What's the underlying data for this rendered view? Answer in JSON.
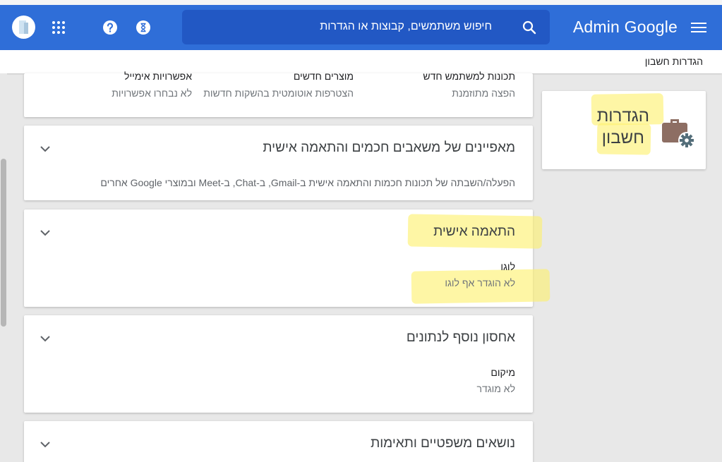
{
  "header": {
    "brand": "Admin Google",
    "search_placeholder": "חיפוש משתמשים, קבוצות או הגדרות"
  },
  "breadcrumb": "הגדרות חשבון",
  "top_card": {
    "columns": [
      {
        "label": "תכונות למשתמש חדש",
        "value": "הפצה מתוזמנת"
      },
      {
        "label": "מוצרים חדשים",
        "value": "הצטרפות אוטומטית בהשקות חדשות"
      },
      {
        "label": "אפשרויות אימייל",
        "value": "לא נבחרו אפשרויות"
      }
    ]
  },
  "sections": [
    {
      "title": "מאפיינים של משאבים חכמים והתאמה אישית",
      "description": "הפעלה/השבתה של תכונות חכמות והתאמה אישית ב-Gmail, ב-Chat, ב-Meet ובמוצרי Google אחרים"
    },
    {
      "title": "התאמה אישית",
      "label": "לוגו",
      "value": "לא הוגדר אף לוגו"
    },
    {
      "title": "אחסון נוסף לנתונים",
      "label": "מיקום",
      "value": "לא מוגדר"
    },
    {
      "title": "נושאים משפטיים ותאימות"
    }
  ],
  "side_card": {
    "title_line1": "הגדרות",
    "title_line2": "חשבון"
  },
  "colors": {
    "header_blue": "#2f6ed8",
    "search_blue": "#2258c4",
    "highlight": "#fdf06e",
    "briefcase": "#8d6e63",
    "gear": "#546e7a"
  }
}
